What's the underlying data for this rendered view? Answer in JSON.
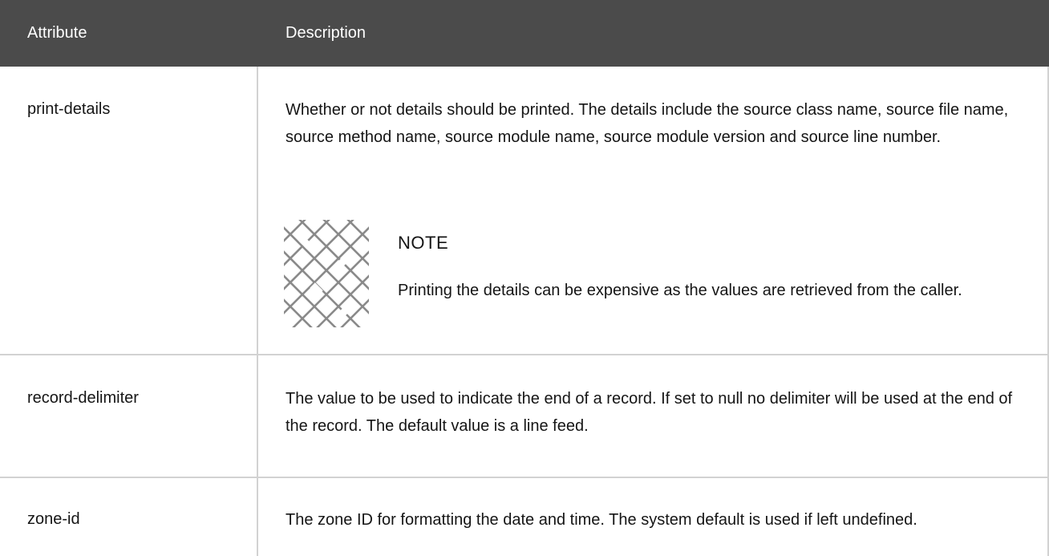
{
  "table": {
    "headers": {
      "attribute": "Attribute",
      "description": "Description"
    },
    "rows": [
      {
        "attribute": "print-details",
        "description": "Whether or not details should be printed. The details include the source class name, source file name, source method name, source module name, source module version and source line number.",
        "note": {
          "icon": "note-icon",
          "title": "NOTE",
          "text": "Printing the details can be expensive as the values are retrieved from the caller."
        }
      },
      {
        "attribute": "record-delimiter",
        "description": "The value to be used to indicate the end of a record. If set to null no delimiter will be used at the end of the record. The default value is a line feed."
      },
      {
        "attribute": "zone-id",
        "description": "The zone ID for formatting the date and time. The system default is used if left undefined."
      }
    ]
  },
  "colors": {
    "header_bg": "#4b4b4b",
    "header_text": "#ffffff",
    "grid": "#d2d2d2",
    "text": "#151515"
  }
}
